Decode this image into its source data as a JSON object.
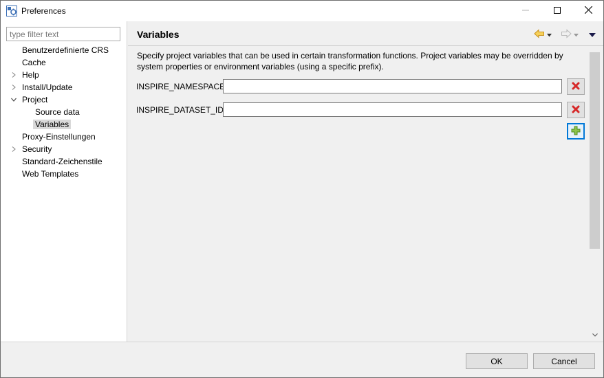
{
  "window": {
    "title": "Preferences"
  },
  "filter": {
    "placeholder": "type filter text"
  },
  "tree": {
    "items": [
      {
        "label": "Benutzerdefinierte CRS",
        "expander": "none"
      },
      {
        "label": "Cache",
        "expander": "none"
      },
      {
        "label": "Help",
        "expander": "collapsed"
      },
      {
        "label": "Install/Update",
        "expander": "collapsed"
      },
      {
        "label": "Project",
        "expander": "expanded"
      },
      {
        "label": "Source data",
        "expander": "none",
        "child": true
      },
      {
        "label": "Variables",
        "expander": "none",
        "child": true,
        "selected": true
      },
      {
        "label": "Proxy-Einstellungen",
        "expander": "none"
      },
      {
        "label": "Security",
        "expander": "collapsed"
      },
      {
        "label": "Standard-Zeichenstile",
        "expander": "none"
      },
      {
        "label": "Web Templates",
        "expander": "none"
      }
    ]
  },
  "page": {
    "title": "Variables",
    "description": "Specify project variables that can be used in certain transformation functions. Project variables may be overridden by system properties or environment variables (using a specific prefix).",
    "variables": [
      {
        "name": "INSPIRE_NAMESPACE",
        "value": ""
      },
      {
        "name": "INSPIRE_DATASET_ID",
        "value": ""
      }
    ]
  },
  "buttons": {
    "ok": "OK",
    "cancel": "Cancel"
  },
  "colors": {
    "remove_icon": "#d62828",
    "add_icon": "#5aa02c",
    "nav_back": "#e6a817",
    "nav_forward_disabled": "#c8c8c8"
  },
  "icons": {
    "app": "preferences-icon",
    "minimize": "minimize-icon",
    "maximize": "maximize-icon",
    "close": "close-icon",
    "back": "back-arrow-icon",
    "forward": "forward-arrow-icon",
    "view_menu": "view-menu-icon",
    "remove": "remove-icon",
    "add": "add-icon"
  }
}
